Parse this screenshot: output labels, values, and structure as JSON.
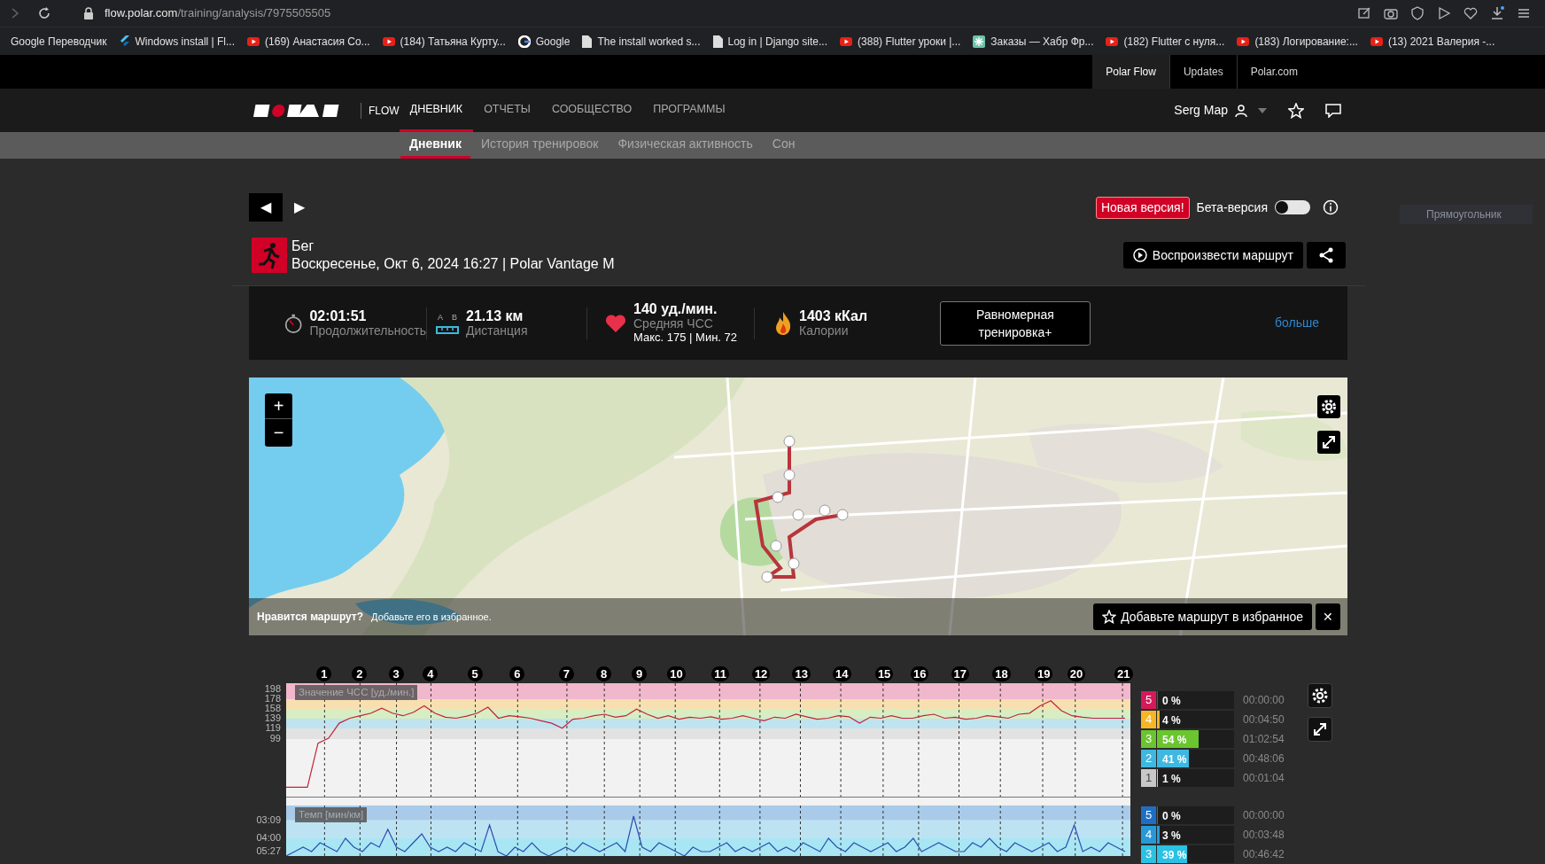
{
  "browser": {
    "url_host": "flow.polar.com",
    "url_path": "/training/analysis/7975505505",
    "bookmarks": [
      {
        "kind": "none",
        "label": "Google Переводчик"
      },
      {
        "kind": "flutter",
        "label": "Windows install | Fl..."
      },
      {
        "kind": "youtube",
        "label": "(169) Анастасия Со..."
      },
      {
        "kind": "youtube",
        "label": "(184) Татьяна Курту..."
      },
      {
        "kind": "google",
        "label": "Google"
      },
      {
        "kind": "doc",
        "label": "The install worked s..."
      },
      {
        "kind": "doc",
        "label": "Log in | Django site..."
      },
      {
        "kind": "youtube",
        "label": "(388) Flutter уроки |..."
      },
      {
        "kind": "habr",
        "label": "Заказы — Хабр Фр..."
      },
      {
        "kind": "youtube",
        "label": "(182) Flutter с нуля..."
      },
      {
        "kind": "youtube",
        "label": "(183) Логирование:..."
      },
      {
        "kind": "youtube",
        "label": "(13) 2021 Валерия -..."
      }
    ]
  },
  "site_tabs": [
    {
      "label": "Polar Flow",
      "selected": true
    },
    {
      "label": "Updates",
      "selected": false
    },
    {
      "label": "Polar.com",
      "selected": false
    }
  ],
  "nav": {
    "product": "FLOW",
    "items": [
      {
        "label": "ДНЕВНИК",
        "selected": true
      },
      {
        "label": "ОТЧЕТЫ",
        "selected": false
      },
      {
        "label": "СООБЩЕСТВО",
        "selected": false
      },
      {
        "label": "ПРОГРАММЫ",
        "selected": false
      }
    ],
    "user": "Serg Map"
  },
  "subnav": [
    {
      "label": "Дневник",
      "selected": true
    },
    {
      "label": "История тренировок",
      "selected": false
    },
    {
      "label": "Физическая активность",
      "selected": false
    },
    {
      "label": "Сон",
      "selected": false
    }
  ],
  "prev": "◀",
  "next": "▶",
  "new_version_badge": "Новая версия!",
  "beta": {
    "label": "Бета-версия",
    "on": false
  },
  "side_hint": "Прямоугольник",
  "session": {
    "sport": "Бег",
    "details": "Воскресенье, Окт 6, 2024 16:27 | Polar Vantage M",
    "replay_button": "Воспроизвести маршрут"
  },
  "summary": {
    "duration": {
      "value": "02:01:51",
      "label": "Продолжительность"
    },
    "distance": {
      "marks": [
        "A",
        "B"
      ],
      "value": "21.13 км",
      "label": "Дистанция"
    },
    "heart_rate": {
      "value": "140 уд./мин.",
      "label": "Средняя ЧСС",
      "range": "Макс. 175  |  Мин. 72"
    },
    "calories": {
      "value": "1403 кКал",
      "label": "Калории"
    },
    "benefit_button": "Равномерная тренировка+",
    "more_link": "больше"
  },
  "map": {
    "zoom_in": "+",
    "zoom_out": "−",
    "favorite_prompt": "Нравится маршрут?",
    "favorite_hint": "Добавьте его в избранное.",
    "favorite_button": "Добавьте маршрут в избранное",
    "close": "✕"
  },
  "laps": [
    "1",
    "2",
    "3",
    "4",
    "5",
    "6",
    "7",
    "8",
    "9",
    "10",
    "11",
    "12",
    "13",
    "14",
    "15",
    "16",
    "17",
    "18",
    "19",
    "20",
    "21"
  ],
  "hr_chart": {
    "label": "Значение ЧСС [уд./мин.]",
    "chart_data": {
      "type": "line",
      "ylim": [
        -17,
        210
      ],
      "yticks": [
        99,
        119,
        139,
        158,
        178,
        198
      ],
      "series": [
        {
          "color": "#c0243a",
          "values": [
            2,
            2,
            2,
            90,
            100,
            130,
            140,
            145,
            150,
            160,
            150,
            145,
            152,
            165,
            150,
            142,
            140,
            144,
            150,
            162,
            140,
            145,
            143,
            140,
            135,
            130,
            120,
            138,
            140,
            145,
            148,
            142,
            145,
            158,
            148,
            140,
            145,
            138,
            142,
            140,
            143,
            138,
            140,
            145,
            140,
            135,
            142,
            140,
            148,
            143,
            138,
            140,
            145,
            143,
            130,
            142,
            140,
            145,
            140,
            140,
            145,
            148,
            140,
            142,
            138,
            140,
            145,
            143,
            140,
            148,
            150,
            165,
            175,
            155,
            145,
            142,
            140,
            140,
            140,
            140
          ]
        }
      ]
    }
  },
  "hr_zones": [
    {
      "zone": "5",
      "percent": "0 %",
      "level": 0,
      "time": "00:00:00",
      "color": "#d6195b"
    },
    {
      "zone": "4",
      "percent": "4 %",
      "level": 0.04,
      "time": "00:04:50",
      "color": "#f5b625"
    },
    {
      "zone": "3",
      "percent": "54 %",
      "level": 0.54,
      "time": "01:02:54",
      "color": "#6ac52e"
    },
    {
      "zone": "2",
      "percent": "41 %",
      "level": 0.41,
      "time": "00:48:06",
      "color": "#3eb8e0"
    },
    {
      "zone": "1",
      "percent": "1 %",
      "level": 0.01,
      "time": "00:01:04",
      "color": "#c8c8c8"
    }
  ],
  "pace_chart": {
    "label": "Темп [мин/км]",
    "axis_labels": [
      "03:09",
      "04:00",
      "05:27"
    ]
  },
  "pace_zones": [
    {
      "zone": "5",
      "percent": "0 %",
      "level": 0,
      "time": "00:00:00",
      "color": "#1e6fc4"
    },
    {
      "zone": "4",
      "percent": "3 %",
      "level": 0.03,
      "time": "00:03:48",
      "color": "#2899d8"
    },
    {
      "zone": "3",
      "percent": "39 %",
      "level": 0.39,
      "time": "00:46:42",
      "color": "#2bc1e4"
    }
  ]
}
